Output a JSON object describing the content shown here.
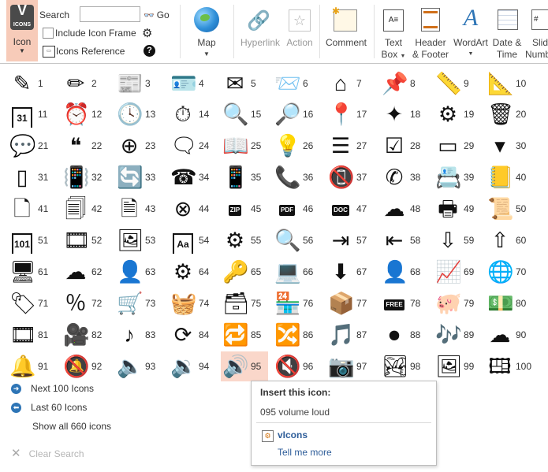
{
  "ribbon": {
    "icon_label": "Icon",
    "icon_logo_text": "ICONS",
    "search_label": "Search",
    "search_value": "",
    "go_label": "Go",
    "include_frame_label": "Include Icon Frame",
    "icons_reference_label": "Icons Reference",
    "map_label": "Map",
    "hyperlink_label": "Hyperlink",
    "action_label": "Action",
    "comment_label": "Comment",
    "text_box_label1": "Text",
    "text_box_label2": "Box",
    "header_footer_label1": "Header",
    "header_footer_label2": "& Footer",
    "wordart_label": "WordArt",
    "date_time_label1": "Date &",
    "date_time_label2": "Time",
    "slide_number_label1": "Slid",
    "slide_number_label2": "Numb"
  },
  "gallery": {
    "selected_index": 95,
    "icons": [
      {
        "n": "1",
        "name": "edit"
      },
      {
        "n": "2",
        "name": "pencil"
      },
      {
        "n": "3",
        "name": "newspaper"
      },
      {
        "n": "4",
        "name": "id-card"
      },
      {
        "n": "5",
        "name": "send-mail"
      },
      {
        "n": "6",
        "name": "open-envelope"
      },
      {
        "n": "7",
        "name": "home"
      },
      {
        "n": "8",
        "name": "pushpin"
      },
      {
        "n": "9",
        "name": "pencil-ruler"
      },
      {
        "n": "10",
        "name": "design"
      },
      {
        "n": "11",
        "name": "calendar"
      },
      {
        "n": "12",
        "name": "alarm-clock"
      },
      {
        "n": "13",
        "name": "clock"
      },
      {
        "n": "14",
        "name": "stopwatch"
      },
      {
        "n": "15",
        "name": "magnifier"
      },
      {
        "n": "16",
        "name": "magnifier-circle"
      },
      {
        "n": "17",
        "name": "location-pin"
      },
      {
        "n": "18",
        "name": "compass"
      },
      {
        "n": "19",
        "name": "gears"
      },
      {
        "n": "20",
        "name": "trash"
      },
      {
        "n": "21",
        "name": "speech-bubble"
      },
      {
        "n": "22",
        "name": "quote-bubble"
      },
      {
        "n": "23",
        "name": "add-bubble"
      },
      {
        "n": "24",
        "name": "chat"
      },
      {
        "n": "25",
        "name": "book"
      },
      {
        "n": "26",
        "name": "desk-lamp"
      },
      {
        "n": "27",
        "name": "list"
      },
      {
        "n": "28",
        "name": "checklist"
      },
      {
        "n": "29",
        "name": "browser"
      },
      {
        "n": "30",
        "name": "dropdown"
      },
      {
        "n": "31",
        "name": "smartphone"
      },
      {
        "n": "32",
        "name": "phone-vibrate"
      },
      {
        "n": "33",
        "name": "phone-rotate"
      },
      {
        "n": "34",
        "name": "fax"
      },
      {
        "n": "35",
        "name": "mobile"
      },
      {
        "n": "36",
        "name": "phone-call"
      },
      {
        "n": "37",
        "name": "phone-mute"
      },
      {
        "n": "38",
        "name": "phone-add"
      },
      {
        "n": "39",
        "name": "address-book"
      },
      {
        "n": "40",
        "name": "phonebook"
      },
      {
        "n": "41",
        "name": "blank-document"
      },
      {
        "n": "42",
        "name": "documents"
      },
      {
        "n": "43",
        "name": "text-document"
      },
      {
        "n": "44",
        "name": "document-delete"
      },
      {
        "n": "45",
        "name": "zip-file"
      },
      {
        "n": "46",
        "name": "pdf-file"
      },
      {
        "n": "47",
        "name": "doc-file"
      },
      {
        "n": "48",
        "name": "cloud-document"
      },
      {
        "n": "49",
        "name": "printer"
      },
      {
        "n": "50",
        "name": "certificate"
      },
      {
        "n": "51",
        "name": "binary-file"
      },
      {
        "n": "52",
        "name": "video-file"
      },
      {
        "n": "53",
        "name": "image-file"
      },
      {
        "n": "54",
        "name": "font-file"
      },
      {
        "n": "55",
        "name": "settings-file"
      },
      {
        "n": "56",
        "name": "search-file"
      },
      {
        "n": "57",
        "name": "import-file"
      },
      {
        "n": "58",
        "name": "export-file"
      },
      {
        "n": "59",
        "name": "download-file"
      },
      {
        "n": "60",
        "name": "upload-file"
      },
      {
        "n": "61",
        "name": "monitor"
      },
      {
        "n": "62",
        "name": "cloud-monitor"
      },
      {
        "n": "63",
        "name": "user-monitor"
      },
      {
        "n": "64",
        "name": "gear-monitor"
      },
      {
        "n": "65",
        "name": "key-monitor"
      },
      {
        "n": "66",
        "name": "laptop-cursor"
      },
      {
        "n": "67",
        "name": "laptop-download"
      },
      {
        "n": "68",
        "name": "laptop-user"
      },
      {
        "n": "69",
        "name": "laptop-chart"
      },
      {
        "n": "70",
        "name": "laptop-web"
      },
      {
        "n": "71",
        "name": "price-tag"
      },
      {
        "n": "72",
        "name": "discount-tag"
      },
      {
        "n": "73",
        "name": "shopping-cart"
      },
      {
        "n": "74",
        "name": "shopping-basket"
      },
      {
        "n": "75",
        "name": "archive-box"
      },
      {
        "n": "76",
        "name": "store"
      },
      {
        "n": "77",
        "name": "package"
      },
      {
        "n": "78",
        "name": "free-tag"
      },
      {
        "n": "79",
        "name": "piggy-bank"
      },
      {
        "n": "80",
        "name": "money"
      },
      {
        "n": "81",
        "name": "film-strip"
      },
      {
        "n": "82",
        "name": "video-camera"
      },
      {
        "n": "83",
        "name": "music-note"
      },
      {
        "n": "84",
        "name": "refresh"
      },
      {
        "n": "85",
        "name": "repeat"
      },
      {
        "n": "86",
        "name": "shuffle"
      },
      {
        "n": "87",
        "name": "music-player"
      },
      {
        "n": "88",
        "name": "ipod"
      },
      {
        "n": "89",
        "name": "music-files"
      },
      {
        "n": "90",
        "name": "music-cloud"
      },
      {
        "n": "91",
        "name": "bell"
      },
      {
        "n": "92",
        "name": "bell-mute"
      },
      {
        "n": "93",
        "name": "volume-low"
      },
      {
        "n": "94",
        "name": "volume-medium"
      },
      {
        "n": "95",
        "name": "volume-loud"
      },
      {
        "n": "96",
        "name": "volume-mute"
      },
      {
        "n": "97",
        "name": "camera"
      },
      {
        "n": "98",
        "name": "picture"
      },
      {
        "n": "99",
        "name": "pictures"
      },
      {
        "n": "100",
        "name": "picture-gallery"
      }
    ]
  },
  "tags": {
    "zip": "ZIP",
    "pdf": "PDF",
    "doc": "DOC",
    "free": "FREE",
    "cal": "31",
    "binary": "101",
    "font": "Aa"
  },
  "nav": {
    "next_label": "Next 100 Icons",
    "last_label": "Last 60 Icons",
    "show_all_label": "Show all 660 icons",
    "clear_label": "Clear Search"
  },
  "tooltip": {
    "title": "Insert this icon:",
    "description": "095 volume loud",
    "addin_name": "vIcons",
    "link": "Tell me more"
  },
  "colors": {
    "selection": "#fad7ca",
    "icon_button": "#f7cbb9",
    "link": "#2e5d99",
    "nav_circle": "#2e75b6"
  }
}
